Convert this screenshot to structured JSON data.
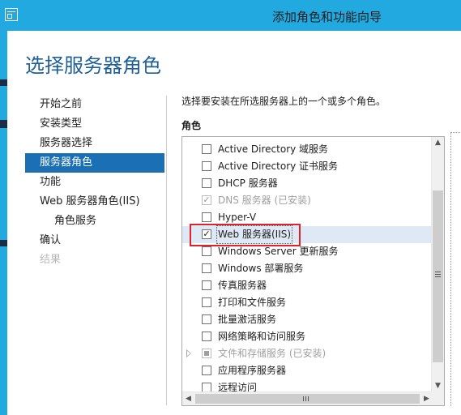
{
  "window": {
    "title": "添加角色和功能向导"
  },
  "page": {
    "title": "选择服务器角色"
  },
  "nav": {
    "items": [
      {
        "label": "开始之前"
      },
      {
        "label": "安装类型"
      },
      {
        "label": "服务器选择"
      },
      {
        "label": "服务器角色"
      },
      {
        "label": "功能"
      },
      {
        "label": "Web 服务器角色(IIS)"
      },
      {
        "label": "角色服务"
      },
      {
        "label": "确认"
      },
      {
        "label": "结果"
      }
    ],
    "selected": "服务器角色"
  },
  "content": {
    "description": "选择要安装在所选服务器上的一个或多个角色。",
    "roles_label": "角色"
  },
  "roles": [
    {
      "label": "Active Directory 域服务",
      "checked": false
    },
    {
      "label": "Active Directory 证书服务",
      "checked": false
    },
    {
      "label": "DHCP 服务器",
      "checked": false
    },
    {
      "label": "DNS 服务器 (已安装)",
      "checked": true,
      "disabled": true
    },
    {
      "label": "Hyper-V",
      "checked": false
    },
    {
      "label": "Web 服务器(IIS)",
      "checked": true,
      "selected": true
    },
    {
      "label": "Windows Server 更新服务",
      "checked": false
    },
    {
      "label": "Windows 部署服务",
      "checked": false
    },
    {
      "label": "传真服务器",
      "checked": false
    },
    {
      "label": "打印和文件服务",
      "checked": false
    },
    {
      "label": "批量激活服务",
      "checked": false
    },
    {
      "label": "网络策略和访问服务",
      "checked": false
    },
    {
      "label": "文件和存储服务 (已安装)",
      "checked": "partial",
      "disabled": true,
      "expandable": true
    },
    {
      "label": "应用程序服务器",
      "checked": false
    },
    {
      "label": "远程访问",
      "checked": false
    }
  ],
  "colors": {
    "titlebar": "#22a9df",
    "accent_selected": "#1b6fb5",
    "page_title": "#1f5f97",
    "highlight_box": "#e0212b"
  }
}
